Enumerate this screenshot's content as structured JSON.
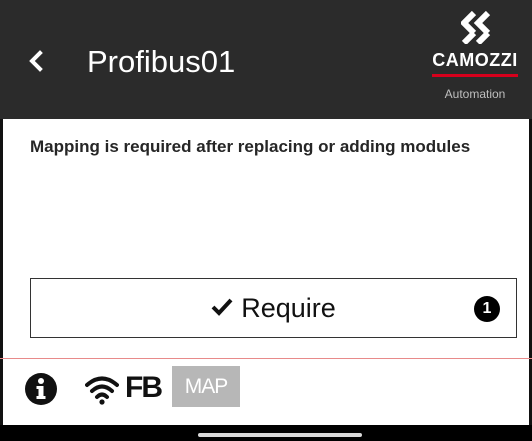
{
  "header": {
    "title": "Profibus01",
    "back_icon": "chevron-left-icon",
    "logo": {
      "name": "CAMOZZI",
      "subtitle": "Automation",
      "accent": "#d6001c"
    }
  },
  "main": {
    "message": "Mapping is required after replacing or adding modules",
    "require_button": {
      "label": "Require",
      "icon": "check-icon",
      "badge": "1"
    }
  },
  "status_bar": {
    "info_icon": "info-icon",
    "wifi_icon": "wifi-icon",
    "fb_label": "FB",
    "map_label": "MAP"
  },
  "colors": {
    "header_bg": "#2b2b2b",
    "divider": "#e88a8a",
    "map_bg": "#b7b7b7"
  }
}
